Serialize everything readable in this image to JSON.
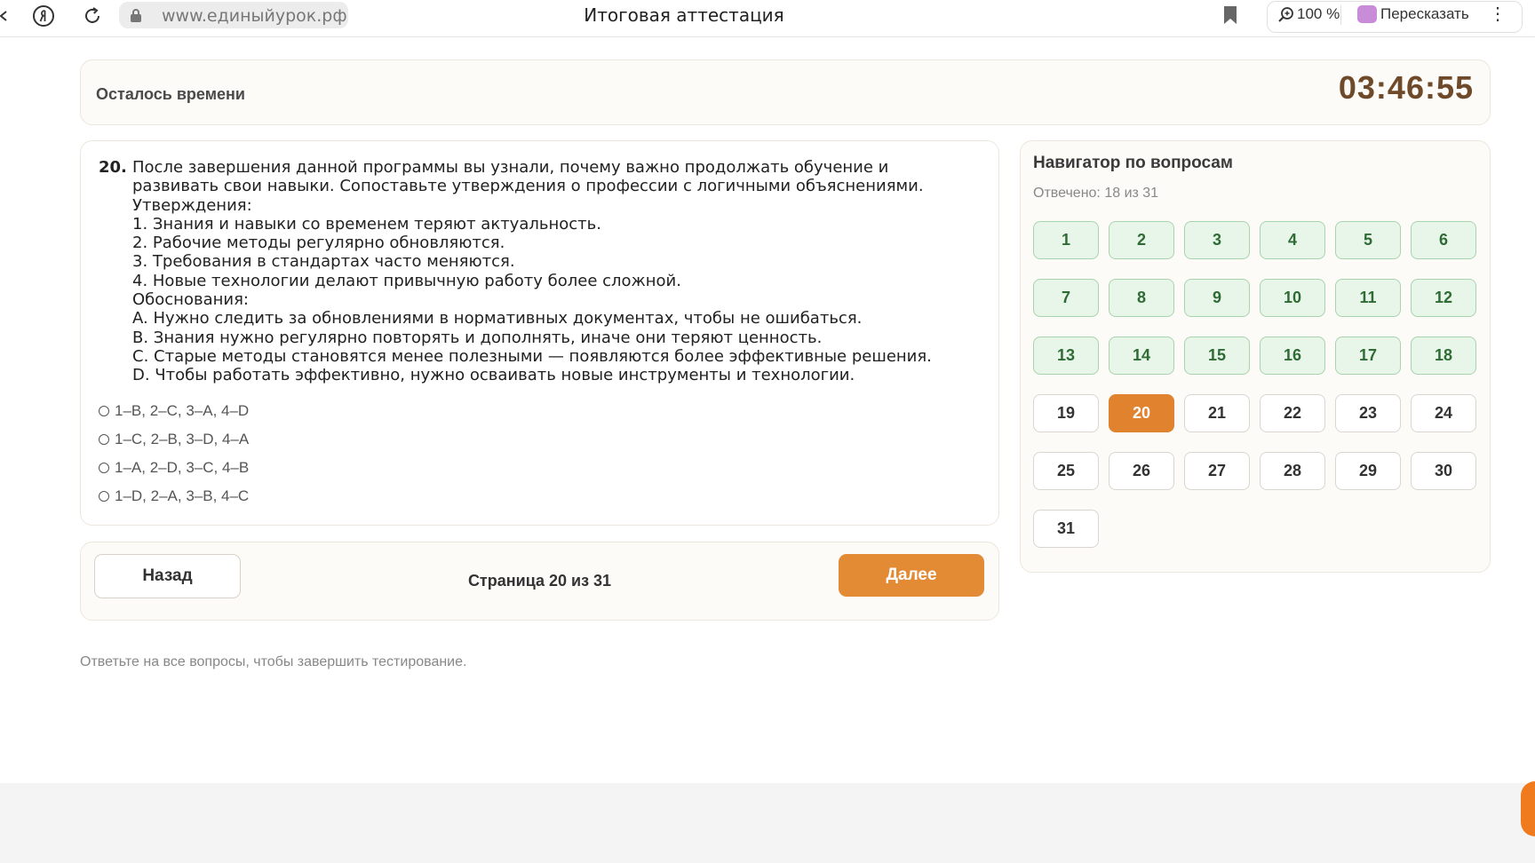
{
  "browser": {
    "url": "www.единыйурок.рф",
    "tab_title": "Итоговая аттестация",
    "zoom": "100 %",
    "retell_label": "Пересказать",
    "more_glyph": "⋮"
  },
  "timer": {
    "label": "Осталось времени",
    "value": "03:46:55"
  },
  "question": {
    "number": "20.",
    "lines": [
      "После завершения данной программы вы узнали, почему важно продолжать обучение и",
      "развивать свои навыки. Сопоставьте утверждения о профессии с логичными объяснениями.",
      "Утверждения:",
      "1. Знания и навыки со временем теряют актуальность.",
      "2. Рабочие методы регулярно обновляются.",
      "3. Требования в стандартах часто меняются.",
      "4. Новые технологии делают привычную работу более сложной.",
      "Обоснования:",
      "A. Нужно следить за обновлениями в нормативных документах, чтобы не ошибаться.",
      "B. Знания нужно регулярно повторять и дополнять, иначе они теряют ценность.",
      "C. Старые методы становятся менее полезными — появляются более эффективные решения.",
      "D. Чтобы работать эффективно, нужно осваивать новые инструменты и технологии."
    ],
    "options": [
      "1–B, 2–C, 3–A, 4–D",
      "1–C, 2–B, 3–D, 4–A",
      "1–A, 2–D, 3–C, 4–B",
      "1–D, 2–A, 3–B, 4–C"
    ]
  },
  "pager": {
    "back_label": "Назад",
    "page_info": "Страница 20 из 31",
    "next_label": "Далее"
  },
  "hint": "Ответьте на все вопросы, чтобы завершить тестирование.",
  "navigator": {
    "title": "Навигатор по вопросам",
    "answered_text": "Отвечено: 18 из 31",
    "total": 31,
    "answered_count": 18,
    "current": 20
  }
}
